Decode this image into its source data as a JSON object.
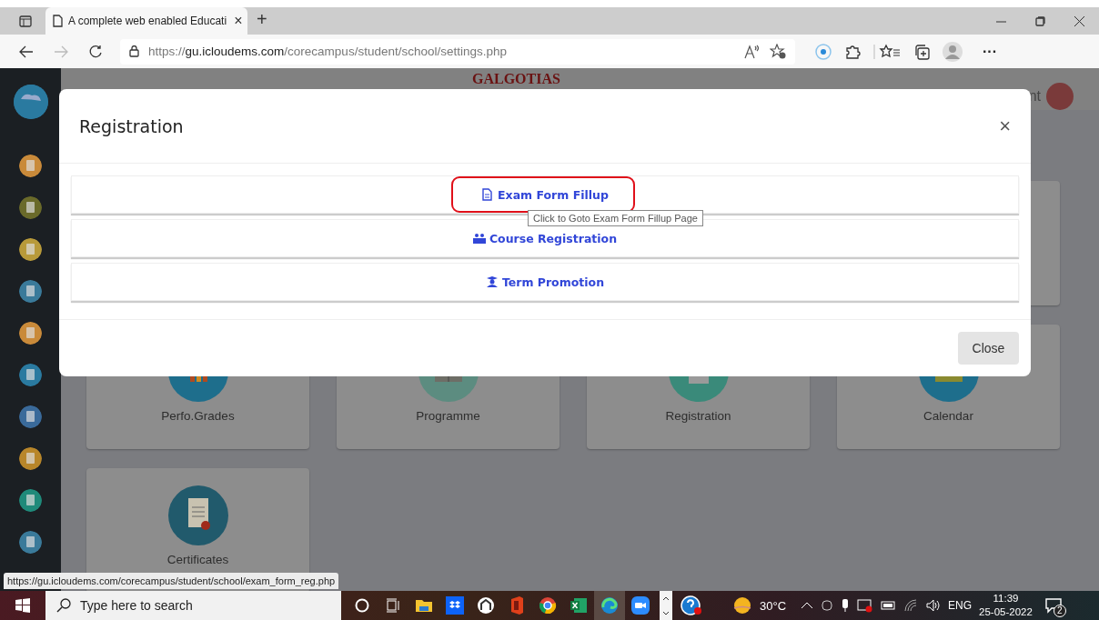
{
  "browser": {
    "tabs": [
      {
        "title": "A complete web enabled Educati",
        "selected": true
      }
    ],
    "close_tab": "×",
    "new_tab": "+",
    "url": "https://**gu.icloudems.com**/corecampus/student/school/settings.php",
    "more": "···"
  },
  "page": {
    "brand": "GALGOTIAS",
    "user_fragment": "nt",
    "cards": [
      {
        "label": "Perfo.Grades",
        "kind": "grades"
      },
      {
        "label": "Programme",
        "kind": "book"
      },
      {
        "label": "Registration",
        "kind": "form"
      },
      {
        "label": "Calendar",
        "kind": "calendar"
      },
      {
        "label": "Certificates",
        "kind": "certificate"
      }
    ]
  },
  "modal": {
    "title": "Registration",
    "close_icon": "×",
    "items": [
      {
        "label": "Exam Form Fillup",
        "kind": "form",
        "highlighted": true
      },
      {
        "label": "Course Registration",
        "kind": "people",
        "highlighted": false
      },
      {
        "label": "Term Promotion",
        "kind": "graduate",
        "highlighted": false
      }
    ],
    "tooltip": "Click to Goto Exam Form Fillup Page",
    "footer_button": "Close"
  },
  "status_url": "https://gu.icloudems.com/corecampus/student/school/exam_form_reg.php",
  "taskbar": {
    "search_placeholder": "Type here to search",
    "apps": [
      {
        "kind": "explorer",
        "selected": false
      },
      {
        "kind": "dropbox",
        "selected": false
      },
      {
        "kind": "app",
        "selected": false
      },
      {
        "kind": "office",
        "selected": false
      },
      {
        "kind": "chrome",
        "selected": false
      },
      {
        "kind": "excel",
        "selected": false
      },
      {
        "kind": "edge",
        "selected": true
      },
      {
        "kind": "zoom",
        "selected": false
      }
    ],
    "temperature": "30°C",
    "language": "ENG",
    "time": "11:39",
    "date": "25-05-2022",
    "notifications": "2"
  }
}
